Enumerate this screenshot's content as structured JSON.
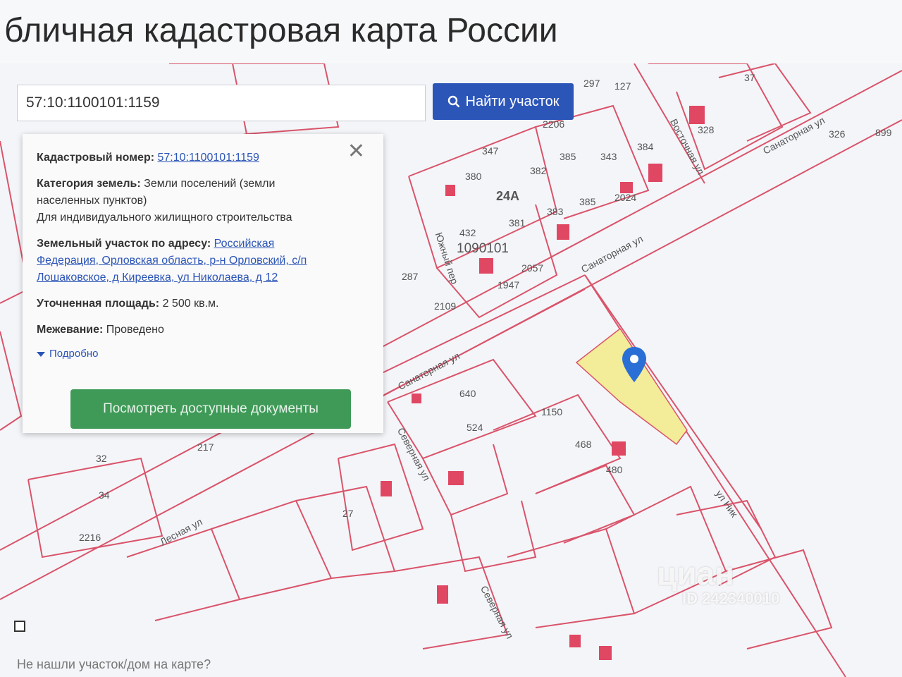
{
  "page": {
    "title": "бличная кадастровая карта России"
  },
  "search": {
    "value": "57:10:1100101:1159",
    "button_label": "Найти участок"
  },
  "info_panel": {
    "cadastral_number_label": "Кадастровый номер:",
    "cadastral_number_value": "57:10:1100101:1159",
    "land_category_label": "Категория земель:",
    "land_category_value_line1": "Земли поселений (земли",
    "land_category_value_line2": "населенных пунктов)",
    "permitted_use": "Для индивидуального жилищного строительства",
    "address_label": "Земельный участок по адресу:",
    "address_line1": "Российская",
    "address_line2": "Федерация, Орловская область, р-н Орловский, с/п",
    "address_line3": "Лошаковское, д Киреевка, ул Николаева, д 12",
    "area_label": "Уточненная площадь:",
    "area_value": "2 500 кв.м.",
    "survey_label": "Межевание:",
    "survey_value": "Проведено",
    "details_label": "Подробно",
    "docs_button_label": "Посмотреть доступные документы",
    "close_symbol": "✕"
  },
  "map": {
    "parcel_labels": [
      "37",
      "328",
      "326",
      "899",
      "2206",
      "297",
      "127",
      "347",
      "380",
      "382",
      "385",
      "343",
      "384",
      "2024",
      "24А",
      "381",
      "383",
      "385",
      "432",
      "1090101",
      "2057",
      "1947",
      "287",
      "2109",
      "640",
      "524",
      "1150",
      "468",
      "480",
      "217",
      "32",
      "34",
      "2216",
      "27"
    ],
    "street_labels": [
      "Санаторная ул",
      "Санаторная ул",
      "Санаторная ул",
      "Восточная ул",
      "Южный пер",
      "Северная ул",
      "Лесная ул",
      "ул Ник",
      "Северная ул"
    ],
    "colors": {
      "line": "#d9546a",
      "building": "#e04763",
      "selected_parcel": "#f3ec98",
      "pin": "#2a6fd6"
    }
  },
  "footer": {
    "link": "Не нашли участок/дом на карте?"
  },
  "watermark": {
    "brand": "циан",
    "id": "ID 242340010"
  }
}
